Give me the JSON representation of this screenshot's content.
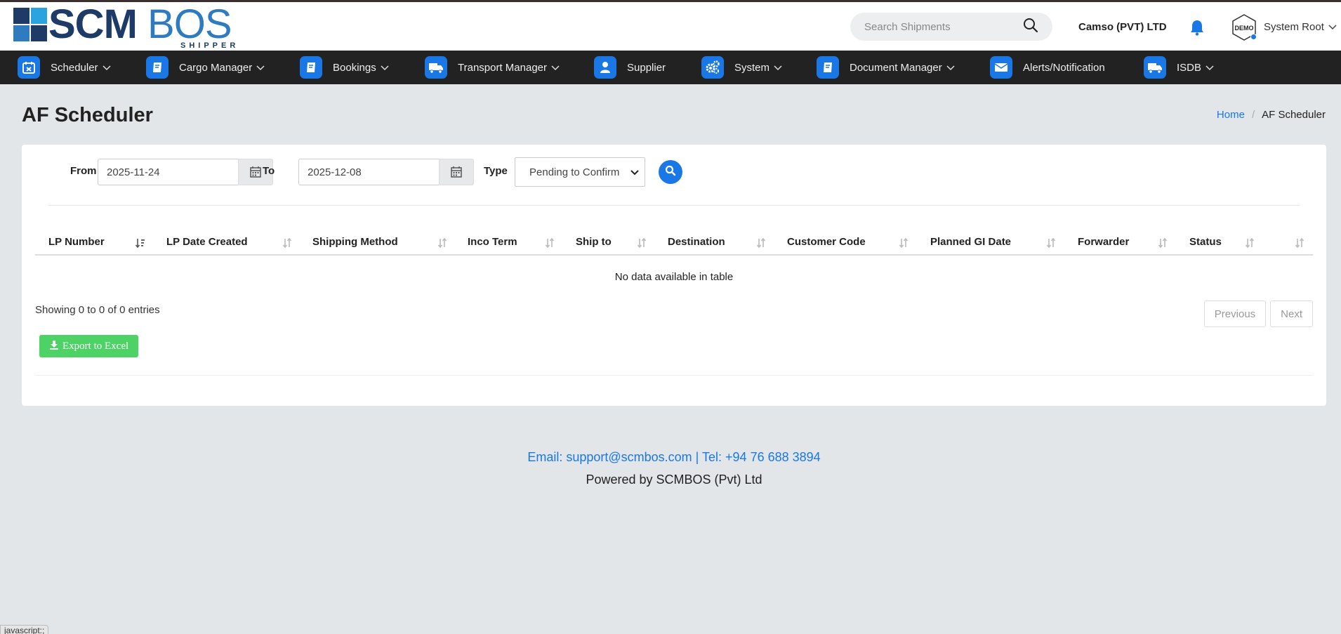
{
  "brand": {
    "logo_main_1": "SCM",
    "logo_main_2": "BOS",
    "logo_sub": "SHIPPER",
    "colors": {
      "dark_blue": "#1d3b66",
      "blue": "#2f7bbf",
      "light_blue": "#2aa3e0",
      "accent": "#1a78e6"
    }
  },
  "header": {
    "search_placeholder": "Search Shipments",
    "company": "Camso (PVT) LTD",
    "user_name": "System Root",
    "avatar_text": "DEMO"
  },
  "nav": {
    "items": [
      {
        "label": "Scheduler",
        "icon": "calendar-icon",
        "has_dropdown": true
      },
      {
        "label": "Cargo Manager",
        "icon": "book-icon",
        "has_dropdown": true
      },
      {
        "label": "Bookings",
        "icon": "book-icon",
        "has_dropdown": true
      },
      {
        "label": "Transport Manager",
        "icon": "truck-icon",
        "has_dropdown": true
      },
      {
        "label": "Supplier",
        "icon": "user-icon",
        "has_dropdown": false
      },
      {
        "label": "System",
        "icon": "gears-icon",
        "has_dropdown": true
      },
      {
        "label": "Document Manager",
        "icon": "book-icon",
        "has_dropdown": true
      },
      {
        "label": "Alerts/Notification",
        "icon": "envelope-icon",
        "has_dropdown": false
      },
      {
        "label": "ISDB",
        "icon": "truck-icon",
        "has_dropdown": true
      }
    ]
  },
  "page": {
    "title": "AF Scheduler",
    "breadcrumb": {
      "home": "Home",
      "current": "AF Scheduler"
    }
  },
  "filters": {
    "from_label": "From",
    "from_value": "2025-11-24",
    "to_label": "To",
    "to_value": "2025-12-08",
    "type_label": "Type",
    "type_value": "Pending to Confirm"
  },
  "table": {
    "columns": [
      "LP Number",
      "LP Date Created",
      "Shipping Method",
      "Inco Term",
      "Ship to",
      "Destination",
      "Customer Code",
      "Planned GI Date",
      "Forwarder",
      "Status"
    ],
    "empty_text": "No data available in table",
    "info": "Showing 0 to 0 of 0 entries",
    "previous": "Previous",
    "next": "Next",
    "export_label": "Export to Excel"
  },
  "footer": {
    "contact": "Email: support@scmbos.com | Tel: +94 76 688 3894",
    "powered": "Powered by SCMBOS (Pvt) Ltd"
  },
  "status_bar": "javascript:;"
}
